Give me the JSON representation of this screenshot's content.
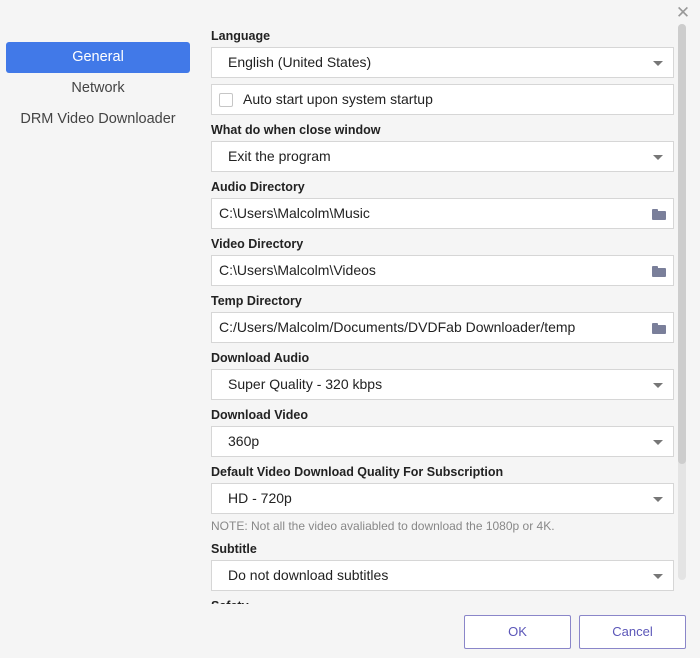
{
  "window": {
    "close_glyph": "✕"
  },
  "sidebar": {
    "items": [
      {
        "label": "General",
        "active": true
      },
      {
        "label": "Network",
        "active": false
      },
      {
        "label": "DRM Video Downloader",
        "active": false
      }
    ]
  },
  "settings": {
    "language": {
      "label": "Language",
      "value": "English (United States)"
    },
    "auto_start": {
      "label": "Auto start upon system startup",
      "checked": false
    },
    "close_window": {
      "label": "What do when close window",
      "value": "Exit the program"
    },
    "audio_dir": {
      "label": "Audio Directory",
      "value": "C:\\Users\\Malcolm\\Music"
    },
    "video_dir": {
      "label": "Video Directory",
      "value": "C:\\Users\\Malcolm\\Videos"
    },
    "temp_dir": {
      "label": "Temp Directory",
      "value": "C:/Users/Malcolm/Documents/DVDFab Downloader/temp"
    },
    "download_audio": {
      "label": "Download Audio",
      "value": "Super Quality - 320 kbps"
    },
    "download_video": {
      "label": "Download Video",
      "value": "360p"
    },
    "subscription_quality": {
      "label": "Default Video Download Quality For Subscription",
      "value": "HD - 720p",
      "note": "NOTE: Not all the video avaliabled to download the 1080p or 4K."
    },
    "subtitle": {
      "label": "Subtitle",
      "value": "Do not download subtitles"
    },
    "safety": {
      "label": "Safety"
    }
  },
  "footer": {
    "ok_label": "OK",
    "cancel_label": "Cancel"
  },
  "colors": {
    "accent": "#4179e8",
    "button_border": "#8a86c9",
    "button_text": "#5b56b8"
  },
  "icons": {
    "folder": "folder-icon",
    "dropdown": "chevron-down-icon",
    "close": "close-icon"
  }
}
